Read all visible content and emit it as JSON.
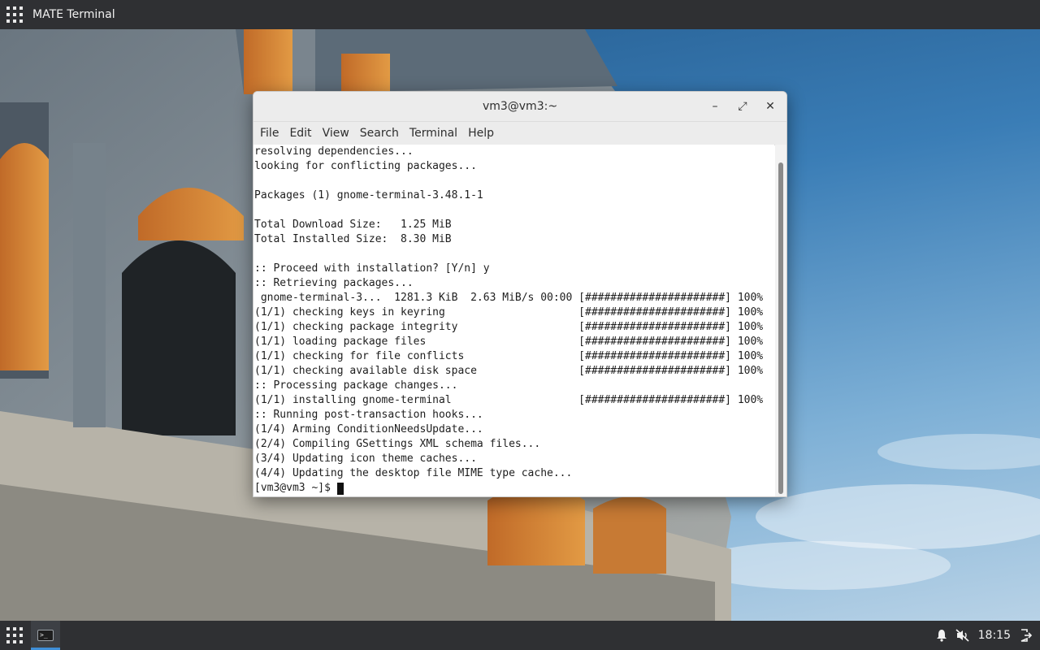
{
  "top_panel": {
    "app_title": "MATE Terminal"
  },
  "window": {
    "title": "vm3@vm3:~",
    "controls": {
      "minimize": "–",
      "maximize": "⤢",
      "close": "✕"
    },
    "menu": [
      "File",
      "Edit",
      "View",
      "Search",
      "Terminal",
      "Help"
    ]
  },
  "terminal": {
    "output": "resolving dependencies...\nlooking for conflicting packages...\n\nPackages (1) gnome-terminal-3.48.1-1\n\nTotal Download Size:   1.25 MiB\nTotal Installed Size:  8.30 MiB\n\n:: Proceed with installation? [Y/n] y\n:: Retrieving packages...\n gnome-terminal-3...  1281.3 KiB  2.63 MiB/s 00:00 [######################] 100%\n(1/1) checking keys in keyring                     [######################] 100%\n(1/1) checking package integrity                   [######################] 100%\n(1/1) loading package files                        [######################] 100%\n(1/1) checking for file conflicts                  [######################] 100%\n(1/1) checking available disk space                [######################] 100%\n:: Processing package changes...\n(1/1) installing gnome-terminal                    [######################] 100%\n:: Running post-transaction hooks...\n(1/4) Arming ConditionNeedsUpdate...\n(2/4) Compiling GSettings XML schema files...\n(3/4) Updating icon theme caches...\n(4/4) Updating the desktop file MIME type cache...",
    "prompt": "[vm3@vm3 ~]$"
  },
  "bottom_panel": {
    "task_icon_glyph": ">_",
    "clock": "18:15"
  },
  "colors": {
    "panel_bg": "#2f3033",
    "task_accent": "#3f8fd8",
    "window_chrome": "#ececec"
  },
  "icons": [
    "apps-grid-icon",
    "minimize-icon",
    "maximize-icon",
    "close-icon",
    "terminal-icon",
    "notification-bell-icon",
    "audio-muted-icon",
    "logout-icon"
  ]
}
